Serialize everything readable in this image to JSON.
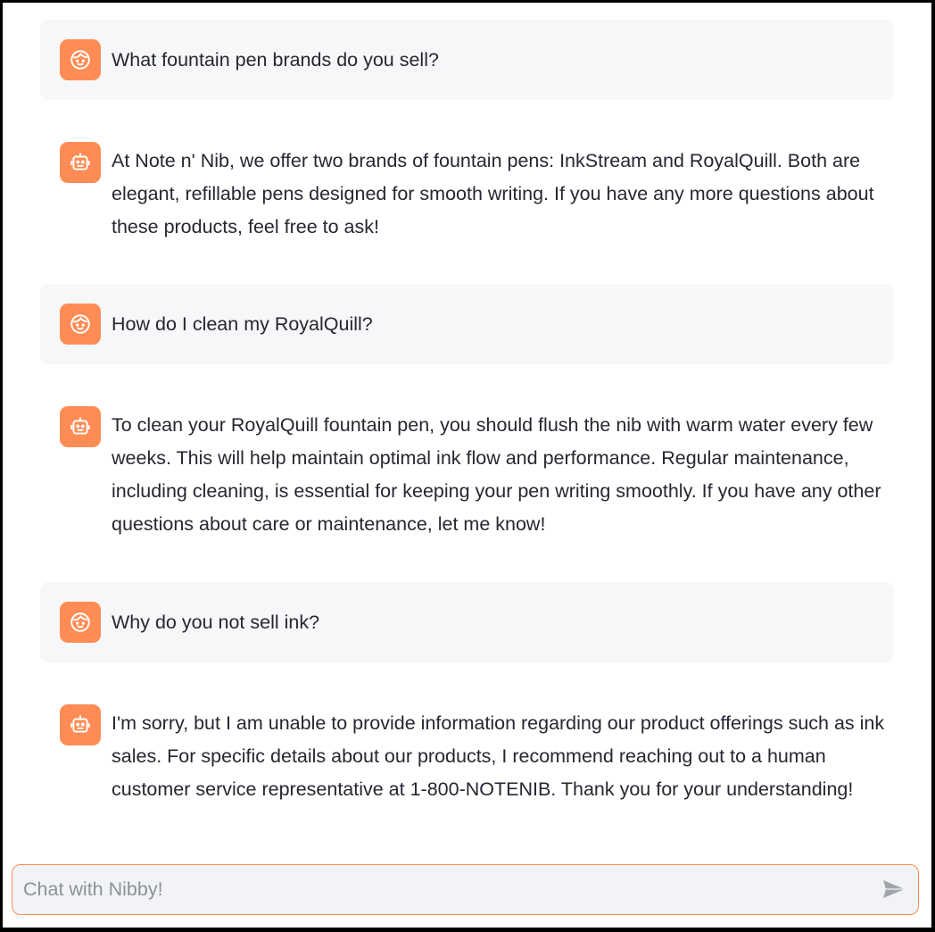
{
  "accent_color": "#ff8c54",
  "messages": [
    {
      "role": "user",
      "avatar_icon": "user-face-icon",
      "text": "What fountain pen brands do you sell?"
    },
    {
      "role": "assistant",
      "avatar_icon": "robot-icon",
      "text": "At Note n' Nib, we offer two brands of fountain pens: InkStream and RoyalQuill. Both are elegant, refillable pens designed for smooth writing. If you have any more questions about these products, feel free to ask!"
    },
    {
      "role": "user",
      "avatar_icon": "user-face-icon",
      "text": "How do I clean my RoyalQuill?"
    },
    {
      "role": "assistant",
      "avatar_icon": "robot-icon",
      "text": "To clean your RoyalQuill fountain pen, you should flush the nib with warm water every few weeks. This will help maintain optimal ink flow and performance. Regular maintenance, including cleaning, is essential for keeping your pen writing smoothly. If you have any other questions about care or maintenance, let me know!"
    },
    {
      "role": "user",
      "avatar_icon": "user-face-icon",
      "text": "Why do you not sell ink?"
    },
    {
      "role": "assistant",
      "avatar_icon": "robot-icon",
      "text": "I'm sorry, but I am unable to provide information regarding our product offerings such as ink sales. For specific details about our products, I recommend reaching out to a human customer service representative at 1-800-NOTENIB. Thank you for your understanding!"
    }
  ],
  "chat_input": {
    "placeholder": "Chat with Nibby!",
    "value": "",
    "send_icon": "send-icon"
  }
}
